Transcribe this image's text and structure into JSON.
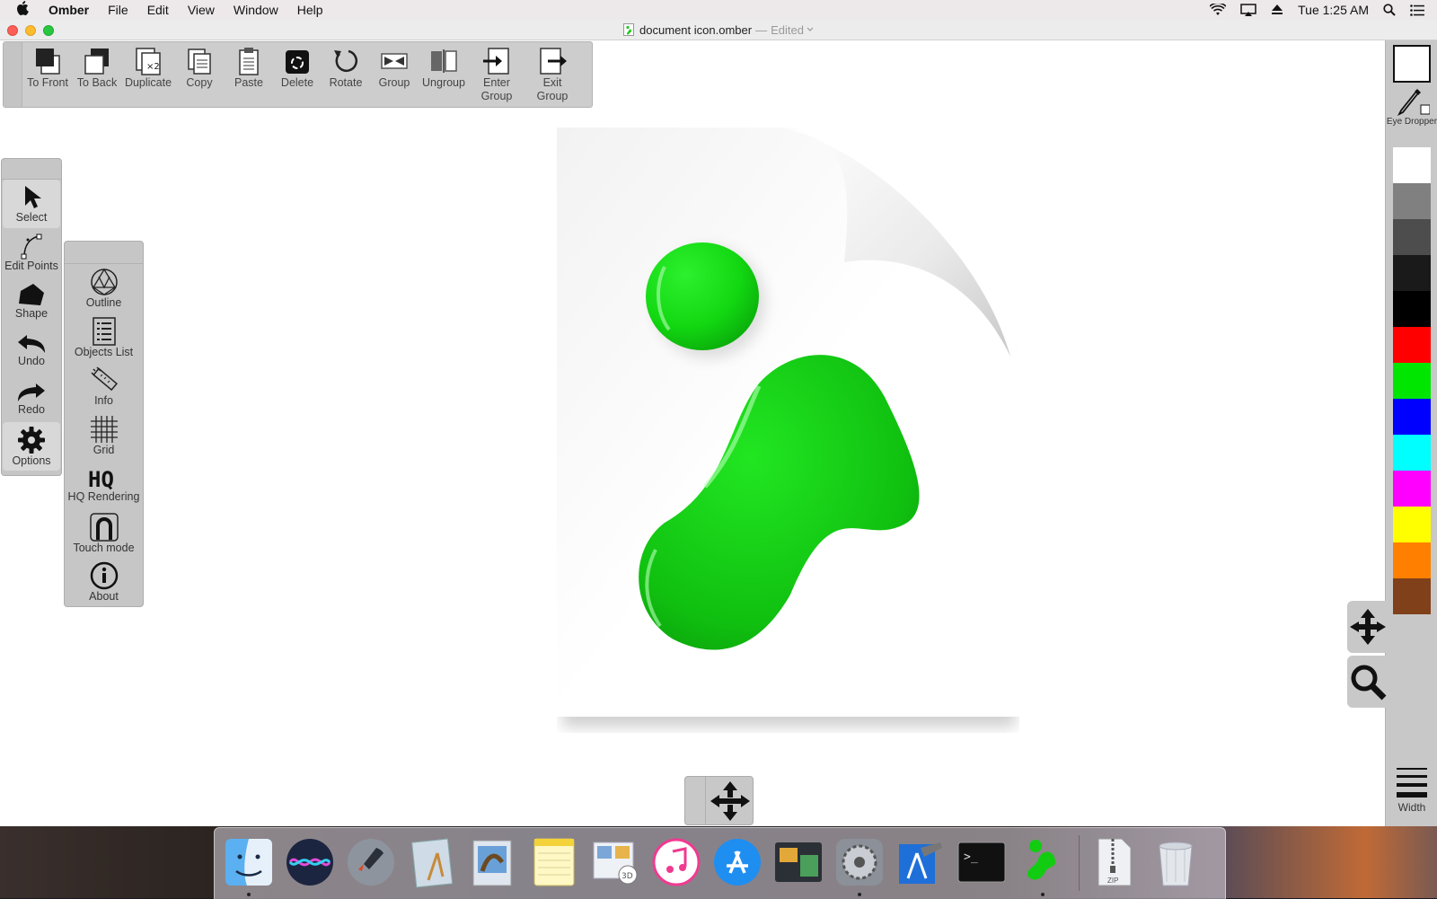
{
  "menubar": {
    "app_name": "Omber",
    "menus": [
      "File",
      "Edit",
      "View",
      "Window",
      "Help"
    ],
    "clock": "Tue 1:25 AM"
  },
  "window": {
    "title": "document icon.omber",
    "separator": "—",
    "status": "Edited"
  },
  "toolbar": {
    "to_front": "To Front",
    "to_back": "To Back",
    "duplicate": "Duplicate",
    "copy": "Copy",
    "paste": "Paste",
    "delete": "Delete",
    "rotate": "Rotate",
    "group": "Group",
    "ungroup": "Ungroup",
    "enter_group_1": "Enter",
    "enter_group_2": "Group",
    "exit_group_1": "Exit",
    "exit_group_2": "Group"
  },
  "tools": {
    "select": "Select",
    "edit_points": "Edit Points",
    "shape": "Shape",
    "undo": "Undo",
    "redo": "Redo",
    "options": "Options"
  },
  "options_menu": {
    "outline": "Outline",
    "objects_list": "Objects List",
    "info": "Info",
    "grid": "Grid",
    "hq_rendering": "HQ Rendering",
    "touch_mode": "Touch mode",
    "about": "About"
  },
  "right_panel": {
    "eye_dropper": "Eye Dropper",
    "width": "Width",
    "selected_color": "#ffffff",
    "palette": [
      "#ffffff",
      "#808080",
      "#4d4d4d",
      "#1a1a1a",
      "#000000",
      "#ff0000",
      "#00e600",
      "#0000ff",
      "#00ffff",
      "#ff00ff",
      "#ffff00",
      "#ff8000",
      "#80401a"
    ]
  },
  "dock": {
    "zip_label": "ZIP"
  }
}
